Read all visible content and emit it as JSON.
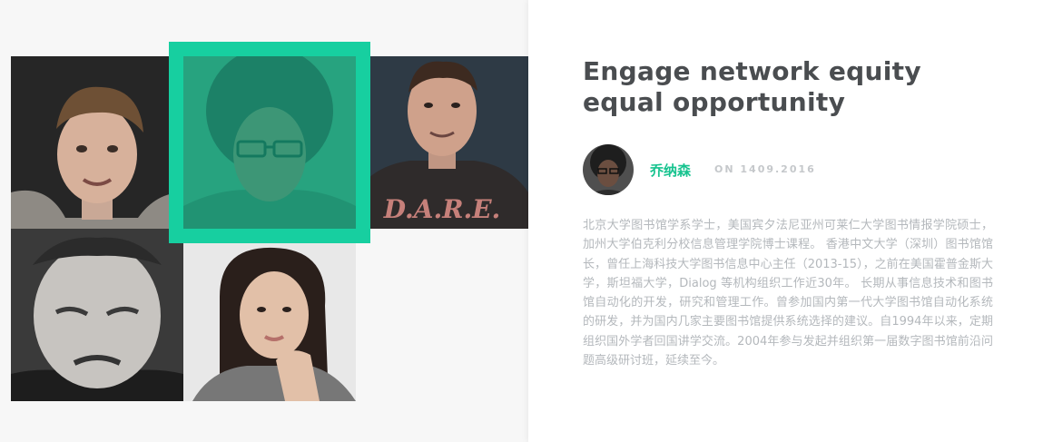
{
  "article": {
    "title": "Engage network equity equal opportunity",
    "author": {
      "name": "乔纳森",
      "date_label": "ON 1409.2016"
    },
    "bio": "北京大学图书馆学系学士，美国宾夕法尼亚州可莱仁大学图书情报学院硕士，加州大学伯克利分校信息管理学院博士课程。 香港中文大学（深圳）图书馆馆长，曾任上海科技大学图书信息中心主任（2013-15），之前在美国霍普金斯大学，斯坦福大学，Dialog 等机构组织工作近30年。 长期从事信息技术和图书馆自动化的开发，研究和管理工作。曾参加国内第一代大学图书馆自动化系统的研发，并为国内几家主要图书馆提供系统选择的建议。自1994年以来，定期组织国外学者回国讲学交流。2004年参与发起并组织第一届数字图书馆前沿问题高级研讨班，延续至今。"
  },
  "gallery": {
    "selected_index": 1,
    "shirt_text": "D.A.R.E.",
    "accent_color": "#17cfa0"
  }
}
